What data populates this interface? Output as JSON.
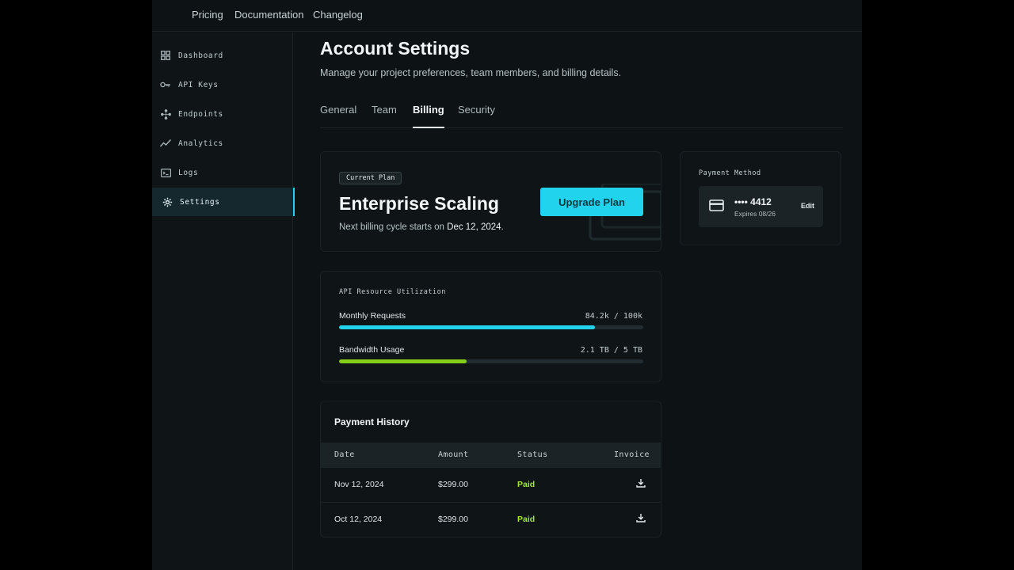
{
  "topnav": {
    "links": [
      "Pricing",
      "Documentation",
      "Changelog"
    ]
  },
  "sidebar": {
    "items": [
      {
        "label": "Dashboard",
        "icon": "grid-icon"
      },
      {
        "label": "API Keys",
        "icon": "key-icon"
      },
      {
        "label": "Endpoints",
        "icon": "endpoints-icon"
      },
      {
        "label": "Analytics",
        "icon": "trend-icon"
      },
      {
        "label": "Logs",
        "icon": "terminal-icon"
      },
      {
        "label": "Settings",
        "icon": "gear-icon",
        "active": true
      }
    ]
  },
  "header": {
    "title": "Account Settings",
    "subtitle": "Manage your project preferences, team members, and billing details."
  },
  "tabs": [
    {
      "label": "General"
    },
    {
      "label": "Team"
    },
    {
      "label": "Billing",
      "active": true
    },
    {
      "label": "Security"
    }
  ],
  "plan": {
    "badge": "Current Plan",
    "name": "Enterprise Scaling",
    "cycle_prefix": "Next billing cycle starts on ",
    "cycle_date": "Dec 12, 2024",
    "cycle_suffix": ".",
    "upgrade_label": "Upgrade Plan"
  },
  "payment_method": {
    "title": "Payment Method",
    "number": "•••• 4412",
    "expires": "Expires 08/26",
    "edit_label": "Edit"
  },
  "usage": {
    "title": "API Resource Utilization",
    "meters": [
      {
        "label": "Monthly Requests",
        "value": "84.2k / 100k",
        "fraction": 0.842,
        "color": "#22d3ee"
      },
      {
        "label": "Bandwidth Usage",
        "value": "2.1 TB / 5 TB",
        "fraction": 0.42,
        "color": "#84cc16"
      }
    ]
  },
  "history": {
    "title": "Payment History",
    "columns": [
      "Date",
      "Amount",
      "Status",
      "Invoice"
    ],
    "rows": [
      {
        "date": "Nov 12, 2024",
        "amount": "$299.00",
        "status": "Paid"
      },
      {
        "date": "Oct 12, 2024",
        "amount": "$299.00",
        "status": "Paid"
      }
    ]
  },
  "colors": {
    "accent": "#22d3ee",
    "success": "#a3e635",
    "background": "#0d1214"
  }
}
